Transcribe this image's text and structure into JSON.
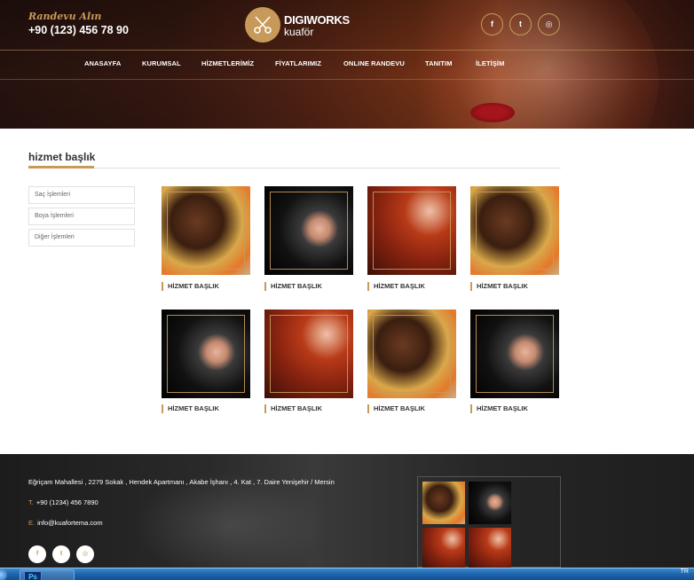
{
  "header": {
    "randevu_label": "Randevu Alın",
    "phone": "+90 (123) 456 78 90",
    "logo": {
      "brand": "DIGIWORKS",
      "sub": "kuaför"
    },
    "social": [
      {
        "icon": "facebook-icon",
        "glyph": "f"
      },
      {
        "icon": "twitter-icon",
        "glyph": "t"
      },
      {
        "icon": "instagram-icon",
        "glyph": "◎"
      }
    ],
    "nav": [
      "ANASAYFA",
      "KURUMSAL",
      "HİZMETLERİMİZ",
      "FİYATLARIMIZ",
      "ONLINE RANDEVU",
      "TANITIM",
      "İLETİŞİM"
    ]
  },
  "main": {
    "section_title": "hizmet başlık",
    "sidebar": [
      "Saç İşlemleri",
      "Boya İşlemleri",
      "Diğer İşlemleri"
    ],
    "tiles": [
      {
        "label": "HİZMET BAŞLIK",
        "tone": "brown"
      },
      {
        "label": "HİZMET BAŞLIK",
        "tone": "black"
      },
      {
        "label": "HİZMET BAŞLIK",
        "tone": "red"
      },
      {
        "label": "HİZMET BAŞLIK",
        "tone": "brown"
      },
      {
        "label": "HİZMET BAŞLIK",
        "tone": "black"
      },
      {
        "label": "HİZMET BAŞLIK",
        "tone": "red"
      },
      {
        "label": "HİZMET BAŞLIK",
        "tone": "brown"
      },
      {
        "label": "HİZMET BAŞLIK",
        "tone": "black"
      }
    ]
  },
  "footer": {
    "address": "Eğriçam Mahallesi , 2279 Sokak , Hendek Apartmanı , Akabe İşhanı , 4. Kat , 7. Daire Yenişehir / Mersin",
    "phone_prefix": "T.",
    "phone": "+90 (1234) 456 7890",
    "email_prefix": "E.",
    "email": "info@kuafortema.com",
    "social": [
      {
        "icon": "facebook-icon",
        "glyph": "f"
      },
      {
        "icon": "twitter-icon",
        "glyph": "t"
      },
      {
        "icon": "instagram-icon",
        "glyph": "◎"
      }
    ],
    "gallery": [
      "brown",
      "black",
      "red",
      "red"
    ]
  },
  "taskbar": {
    "app_icon": "Ps",
    "lang": "TR"
  },
  "colors": {
    "accent": "#c79a5a",
    "footer_bg": "#262626",
    "taskbar": "#1e64ae"
  }
}
